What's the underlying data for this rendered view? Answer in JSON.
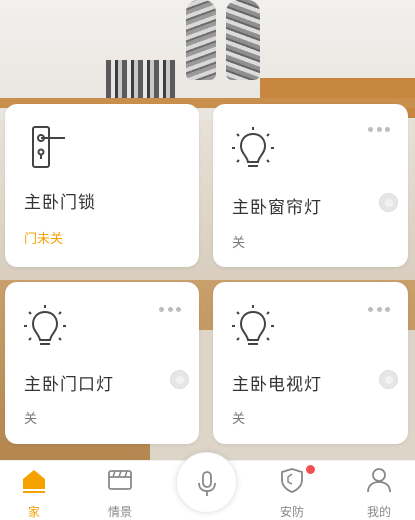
{
  "devices": [
    {
      "title": "主卧门锁",
      "status": "门未关",
      "icon": "door-lock-icon"
    },
    {
      "title": "主卧窗帘灯",
      "status": "关",
      "icon": "light-bulb-icon"
    },
    {
      "title": "主卧门口灯",
      "status": "关",
      "icon": "light-bulb-icon"
    },
    {
      "title": "主卧电视灯",
      "status": "关",
      "icon": "light-bulb-icon"
    }
  ],
  "tabbar": {
    "home": "家",
    "scene": "情景",
    "security": "安防",
    "mine": "我的"
  },
  "colors": {
    "accent": "#f5a100",
    "badge": "#f45050",
    "card_bg": "#ffffff"
  }
}
